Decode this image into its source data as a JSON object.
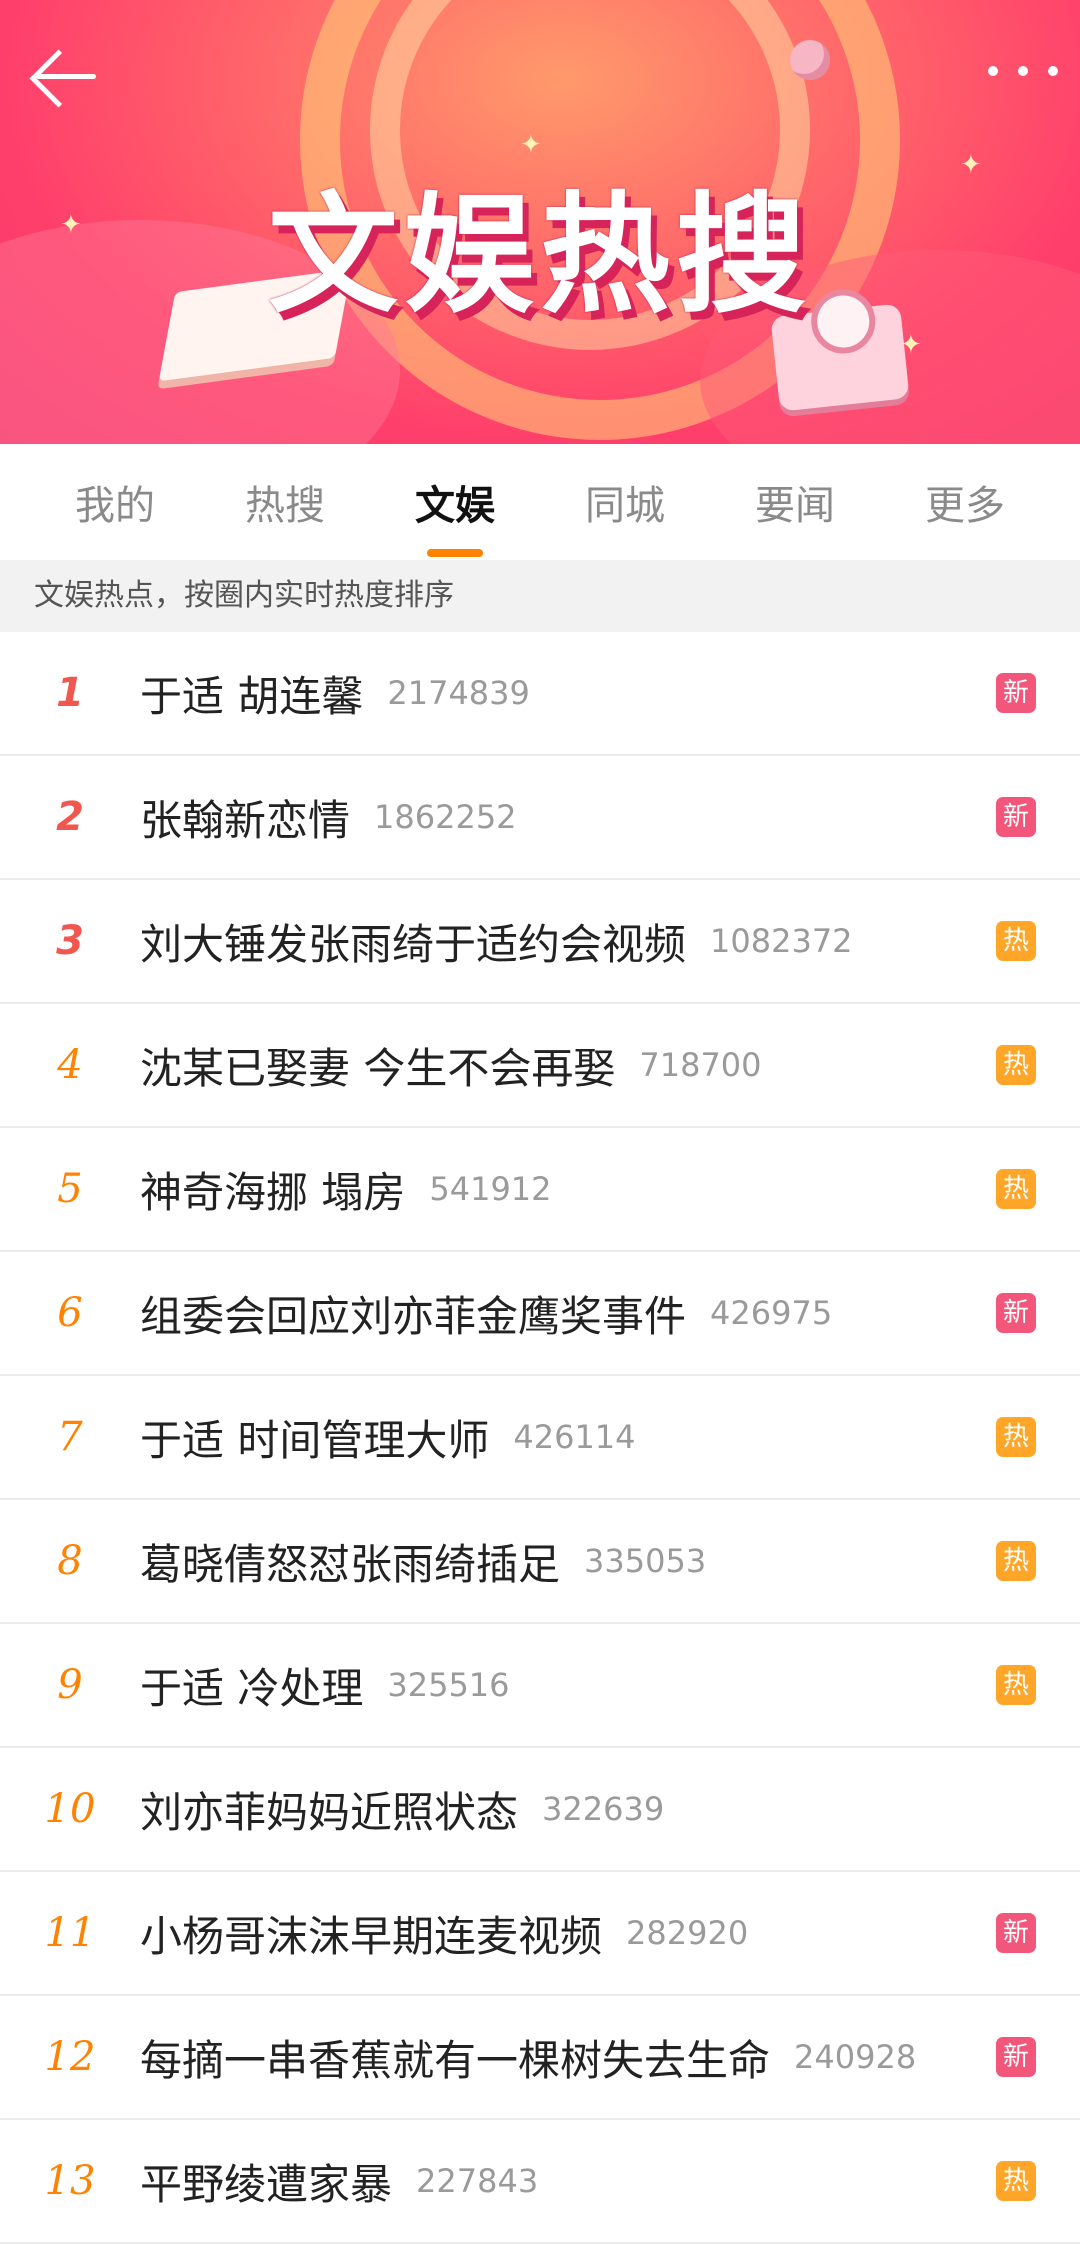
{
  "header": {
    "title": "文娱热搜",
    "back_icon": "arrow-left-icon",
    "more_icon": "more-dots-icon"
  },
  "tabs": [
    {
      "label": "我的",
      "active": false
    },
    {
      "label": "热搜",
      "active": false
    },
    {
      "label": "文娱",
      "active": true
    },
    {
      "label": "同城",
      "active": false
    },
    {
      "label": "要闻",
      "active": false
    },
    {
      "label": "更多",
      "active": false
    }
  ],
  "subheader": "文娱热点，按圈内实时热度排序",
  "colors": {
    "accent": "#ff8200",
    "rank_top": "#f2574f",
    "badge_new": "#f2577b",
    "badge_hot": "#ffa628"
  },
  "items": [
    {
      "rank": "1",
      "title": "于适 胡连馨",
      "count": "2174839",
      "badge": "新",
      "badge_type": "new"
    },
    {
      "rank": "2",
      "title": "张翰新恋情",
      "count": "1862252",
      "badge": "新",
      "badge_type": "new"
    },
    {
      "rank": "3",
      "title": "刘大锤发张雨绮于适约会视频",
      "count": "1082372",
      "badge": "热",
      "badge_type": "hot"
    },
    {
      "rank": "4",
      "title": "沈某已娶妻 今生不会再娶",
      "count": "718700",
      "badge": "热",
      "badge_type": "hot"
    },
    {
      "rank": "5",
      "title": "神奇海挪 塌房",
      "count": "541912",
      "badge": "热",
      "badge_type": "hot"
    },
    {
      "rank": "6",
      "title": "组委会回应刘亦菲金鹰奖事件",
      "count": "426975",
      "badge": "新",
      "badge_type": "new"
    },
    {
      "rank": "7",
      "title": "于适 时间管理大师",
      "count": "426114",
      "badge": "热",
      "badge_type": "hot"
    },
    {
      "rank": "8",
      "title": "葛晓倩怒怼张雨绮插足",
      "count": "335053",
      "badge": "热",
      "badge_type": "hot"
    },
    {
      "rank": "9",
      "title": "于适 冷处理",
      "count": "325516",
      "badge": "热",
      "badge_type": "hot"
    },
    {
      "rank": "10",
      "title": "刘亦菲妈妈近照状态",
      "count": "322639",
      "badge": "",
      "badge_type": ""
    },
    {
      "rank": "11",
      "title": "小杨哥沫沫早期连麦视频",
      "count": "282920",
      "badge": "新",
      "badge_type": "new"
    },
    {
      "rank": "12",
      "title": "每摘一串香蕉就有一棵树失去生命",
      "count": "240928",
      "badge": "新",
      "badge_type": "new"
    },
    {
      "rank": "13",
      "title": "平野绫遭家暴",
      "count": "227843",
      "badge": "热",
      "badge_type": "hot"
    }
  ]
}
